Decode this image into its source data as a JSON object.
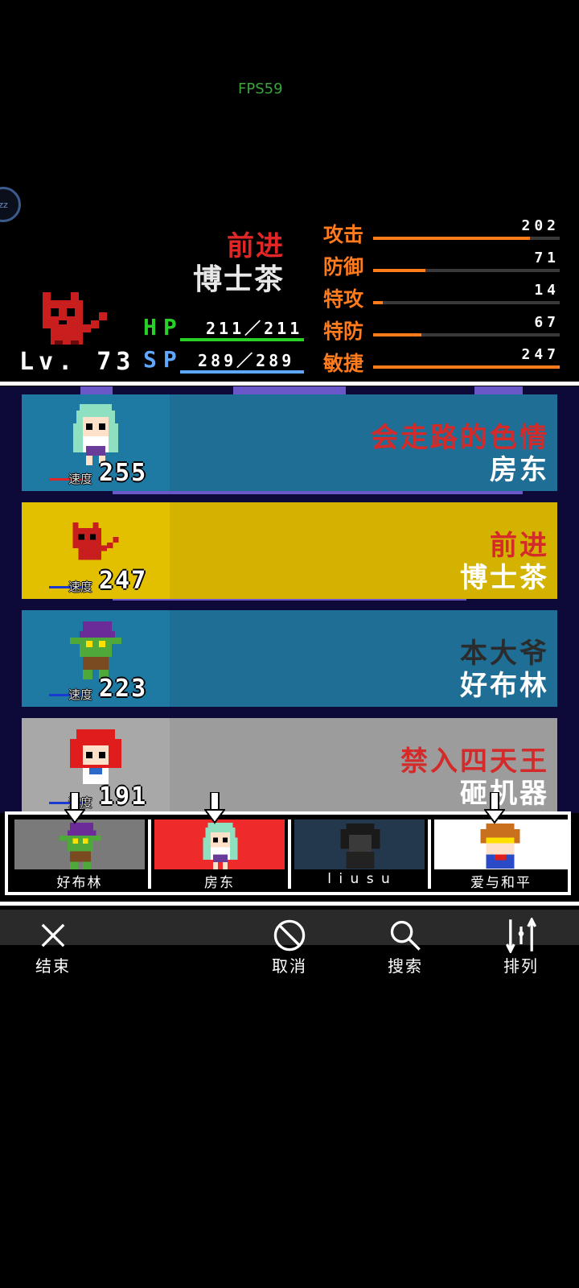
{
  "overlay": {
    "fps": "FPS59",
    "bubble_text": "zz"
  },
  "character": {
    "title": "前进",
    "name": "博士茶",
    "level": "Lv. 73",
    "hp_label": "HP",
    "hp_value": "211／211",
    "hp_fraction": 1.0,
    "sp_label": "SP",
    "sp_value": "289／289",
    "sp_fraction": 1.0
  },
  "stats": [
    {
      "label": "攻击",
      "value": "202",
      "fraction": 0.84
    },
    {
      "label": "防御",
      "value": "71",
      "fraction": 0.28
    },
    {
      "label": "特攻",
      "value": "14",
      "fraction": 0.05
    },
    {
      "label": "特防",
      "value": "67",
      "fraction": 0.26
    },
    {
      "label": "敏捷",
      "value": "247",
      "fraction": 1.0
    }
  ],
  "turn_order": [
    {
      "title": "会走路的色情",
      "name": "房东",
      "speed": "255",
      "speed_label": "速度",
      "bg": "#1e6e96",
      "left_bg": "#1f7aa3",
      "title_color": "#d42a2a",
      "line_color": "#e02626",
      "sprite": "green-haired-girl-sprite"
    },
    {
      "title": "前进",
      "name": "博士茶",
      "speed": "247",
      "speed_label": "速度",
      "bg": "#d4b300",
      "left_bg": "#e2c000",
      "title_color": "#d42a2a",
      "line_color": "#1b3bd0",
      "sprite": "red-cat-sprite"
    },
    {
      "title": "本大爷",
      "name": "好布林",
      "speed": "223",
      "speed_label": "速度",
      "bg": "#1e6e96",
      "left_bg": "#1f7aa3",
      "title_color": "#2b2b2b",
      "line_color": "#1b3bd0",
      "sprite": "goblin-sprite"
    },
    {
      "title": "禁入四天王",
      "name": "砸机器",
      "speed": "191",
      "speed_label": "速度",
      "bg": "#9c9c9c",
      "left_bg": "#a8a8a8",
      "title_color": "#d42a2a",
      "line_color": "#1b3bd0",
      "sprite": "red-haired-girl-sprite"
    }
  ],
  "party": [
    {
      "name": "好布林",
      "bg": "#7a7a7a",
      "sprite": "goblin-sprite",
      "arrow": true
    },
    {
      "name": "房东",
      "bg": "#ee2a2a",
      "sprite": "green-haired-girl-sprite",
      "arrow": true
    },
    {
      "name": "l i u s u",
      "bg": "#23384d",
      "sprite": "dark-silhouette-sprite",
      "arrow": false
    },
    {
      "name": "爱与和平",
      "bg": "#ffffff",
      "sprite": "visor-hero-sprite",
      "arrow": true
    }
  ],
  "menu": [
    {
      "label": "结束",
      "icon": "close-icon"
    },
    {
      "label": "取消",
      "icon": "cancel-icon"
    },
    {
      "label": "搜索",
      "icon": "search-icon"
    },
    {
      "label": "排列",
      "icon": "sort-icon"
    }
  ]
}
